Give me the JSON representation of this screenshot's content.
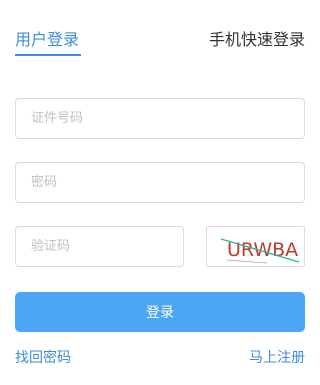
{
  "tabs": {
    "user_login": "用户登录",
    "phone_login": "手机快速登录"
  },
  "form": {
    "id_placeholder": "证件号码",
    "id_value": "",
    "password_placeholder": "密码",
    "password_value": "",
    "captcha_placeholder": "验证码",
    "captcha_value": "",
    "captcha_image_text": "URWBA"
  },
  "login_button": "登录",
  "links": {
    "forgot_password": "找回密码",
    "register": "马上注册"
  },
  "colors": {
    "accent": "#3c8dde",
    "button": "#4da5f5",
    "captcha_text": "#c0392b",
    "captcha_line": "#2bb8a6"
  }
}
